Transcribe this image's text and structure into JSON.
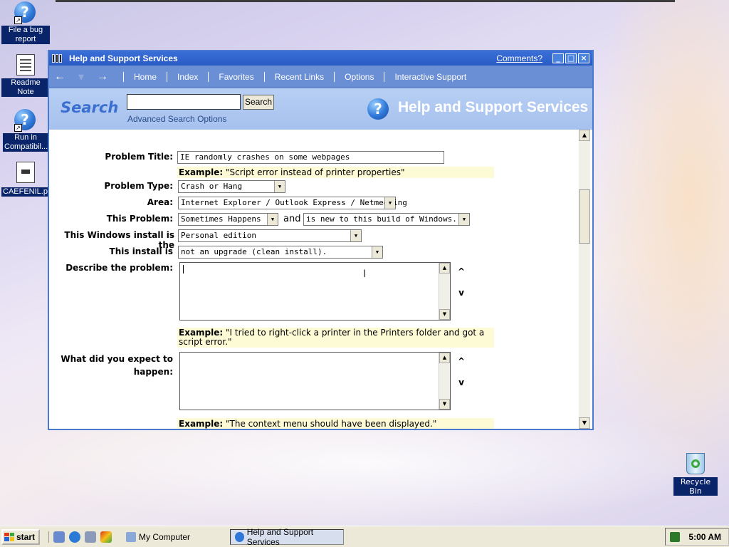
{
  "desktop": {
    "icons": [
      {
        "label": "File a bug report",
        "icon": "help-question-icon"
      },
      {
        "label": "Readme Note",
        "icon": "notepad-document-icon"
      },
      {
        "label": "Run in Compatibil...",
        "icon": "help-question-icon"
      },
      {
        "label": "CAEFENIL.ph",
        "icon": "file-document-icon"
      }
    ],
    "recycle_bin": "Recycle Bin"
  },
  "window": {
    "title": "Help and Support Services",
    "comments_link": "Comments?",
    "controls": [
      "_",
      "□",
      "×"
    ],
    "nav": {
      "back": "←",
      "forward": "→",
      "links": [
        "Home",
        "Index",
        "Favorites",
        "Recent Links",
        "Options",
        "Interactive Support"
      ]
    },
    "search": {
      "label": "Search",
      "input_value": "",
      "button": "Search",
      "advanced": "Advanced Search Options",
      "header_title": "Help and Support Services",
      "header_icon": "?"
    },
    "form": {
      "problem_title": {
        "label": "Problem Title:",
        "value": "IE randomly crashes on some webpages",
        "example_label": "Example:",
        "example_text": " \"Script error instead of printer properties\""
      },
      "problem_type": {
        "label": "Problem Type:",
        "value": "Crash or Hang"
      },
      "area": {
        "label": "Area:",
        "value": "Internet Explorer / Outlook Express / Netmeeting"
      },
      "this_problem": {
        "label": "This Problem:",
        "value": "Sometimes Happens",
        "and": "and",
        "value2": "is new to this build of Windows."
      },
      "install_edition": {
        "label": "This Windows install is the",
        "value": "Personal edition"
      },
      "install_type": {
        "label": "This install is",
        "value": "not an upgrade (clean install)."
      },
      "describe": {
        "label": "Describe the problem:",
        "example_label": "Example:",
        "example_text": " \"I tried to right-click a printer in the Printers folder and got a script error.\""
      },
      "expect": {
        "label_line1": "What did you expect to",
        "label_line2": "happen:",
        "example_label": "Example:",
        "example_text": " \"The context menu should have been displayed.\""
      },
      "expand_up": "^",
      "expand_down": "v"
    }
  },
  "taskbar": {
    "start": "start",
    "tasks": [
      {
        "label": "My Computer",
        "active": false
      },
      {
        "label": "Help and Support Services",
        "active": true
      }
    ],
    "clock": "5:00 AM"
  },
  "colors": {
    "titlebar": "#2a5bc4",
    "navbar": "#6b8fd4",
    "search_band": "#b7cff3",
    "example_bg": "#fdfad6",
    "icon_label_bg": "#0a246a"
  }
}
